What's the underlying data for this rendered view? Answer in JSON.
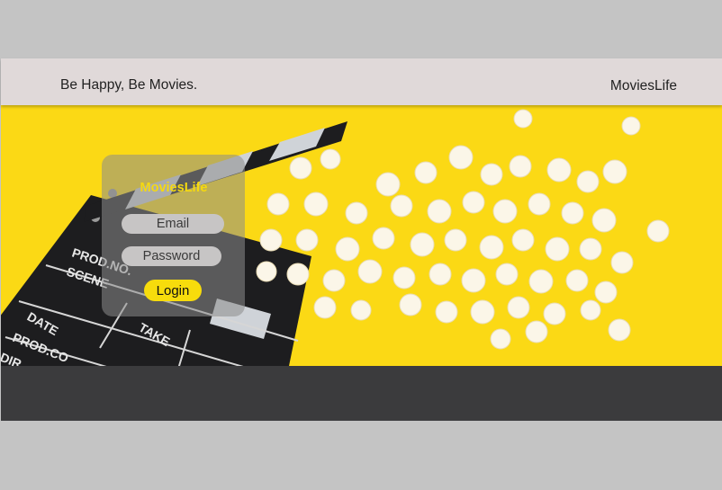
{
  "header": {
    "tagline": "Be Happy, Be Movies.",
    "brand": "MoviesLife"
  },
  "hero": {
    "image": "clapperboard-and-popcorn-photo",
    "background_color": "#fbd915",
    "clapperboard_labels": [
      "PROD.NO.",
      "SCENE",
      "TAKE",
      "DATE",
      "PROD.CO",
      "DIR"
    ]
  },
  "login": {
    "title": "MoviesLife",
    "email_placeholder": "Email",
    "password_placeholder": "Password",
    "button_label": "Login"
  },
  "colors": {
    "header_bg": "#e0d9d9",
    "footer_bg": "#3b3b3d",
    "accent": "#f7dc0c"
  }
}
